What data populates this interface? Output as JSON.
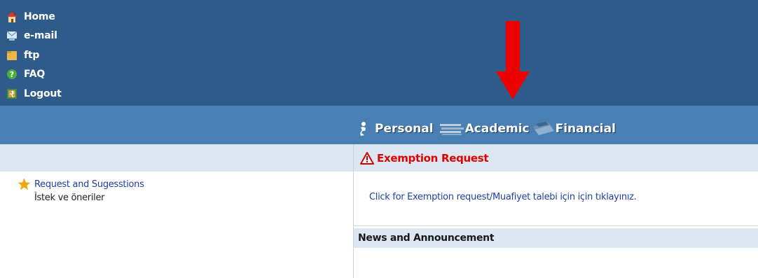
{
  "nav": {
    "items": [
      {
        "label": "Home",
        "icon": "house-icon"
      },
      {
        "label": "e-mail",
        "icon": "mail-icon"
      },
      {
        "label": "ftp",
        "icon": "folder-icon"
      },
      {
        "label": "FAQ",
        "icon": "help-icon"
      },
      {
        "label": "Logout",
        "icon": "logout-icon"
      }
    ]
  },
  "tabs": [
    {
      "label": "Personal",
      "icon": "person-icon"
    },
    {
      "label": "Academic",
      "icon": "books-icon"
    },
    {
      "label": "Financial",
      "icon": "money-icon"
    }
  ],
  "left": {
    "request_link": "Request and Sugesstions",
    "request_sub": "İstek ve öneriler"
  },
  "exemption": {
    "title": "Exemption Request",
    "link": "Click for Exemption request/Muafiyet talebi için için tıklayınız."
  },
  "news": {
    "title": "News and Announcement"
  },
  "colors": {
    "header_bg": "#2f5b8a",
    "tabbar_bg": "#4a7fb4",
    "band_bg": "#dce7f2",
    "alert_red": "#e00000",
    "link_blue": "#1f3fa3",
    "arrow_red": "#ee0000"
  }
}
